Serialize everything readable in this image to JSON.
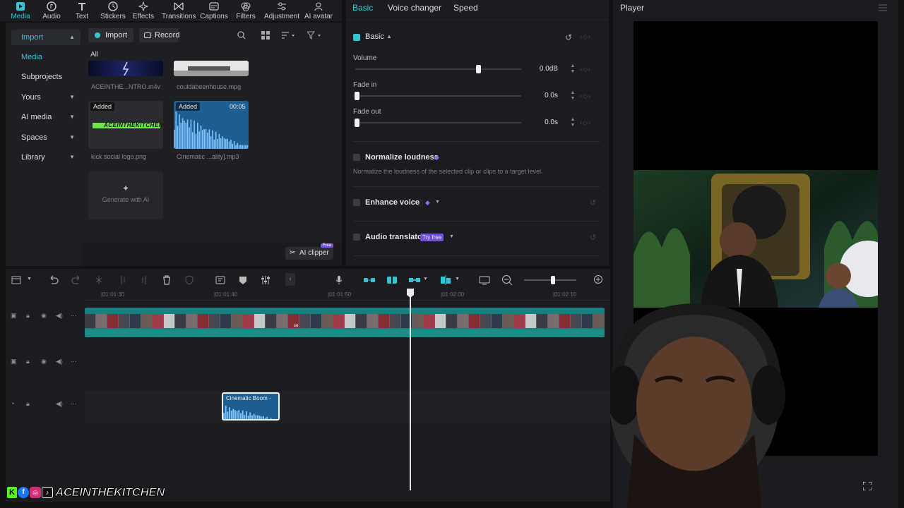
{
  "toolbar": {
    "tabs": [
      {
        "label": "Media",
        "icon": "media-icon"
      },
      {
        "label": "Audio",
        "icon": "audio-icon"
      },
      {
        "label": "Text",
        "icon": "text-icon"
      },
      {
        "label": "Stickers",
        "icon": "stickers-icon"
      },
      {
        "label": "Effects",
        "icon": "effects-icon"
      },
      {
        "label": "Transitions",
        "icon": "transitions-icon"
      },
      {
        "label": "Captions",
        "icon": "captions-icon"
      },
      {
        "label": "Filters",
        "icon": "filters-icon"
      },
      {
        "label": "Adjustment",
        "icon": "adjustment-icon"
      },
      {
        "label": "AI avatar",
        "icon": "ai-avatar-icon"
      }
    ]
  },
  "sidebar": {
    "items": [
      {
        "label": "Import"
      },
      {
        "label": "Media"
      },
      {
        "label": "Subprojects"
      },
      {
        "label": "Yours"
      },
      {
        "label": "AI media"
      },
      {
        "label": "Spaces"
      },
      {
        "label": "Library"
      }
    ]
  },
  "media": {
    "import_label": "Import",
    "record_label": "Record",
    "filter_label": "All",
    "files": [
      {
        "name": "ACEINTHE...NTRO.m4v",
        "badge": "",
        "duration": ""
      },
      {
        "name": "couldabeenhouse.mpg",
        "badge": "",
        "duration": ""
      },
      {
        "name": "kick social logo.png",
        "badge": "Added",
        "duration": ""
      },
      {
        "name": "Cinematic ...ality].mp3",
        "badge": "Added",
        "duration": "00:05"
      }
    ],
    "logo_text": "ACEINTHEKITCHEN",
    "generate_label": "Generate with AI",
    "ai_clipper_label": "AI clipper",
    "free_badge": "Free"
  },
  "props": {
    "tabs": [
      "Basic",
      "Voice changer",
      "Speed"
    ],
    "section": "Basic",
    "volume": {
      "label": "Volume",
      "value": "0.0dB",
      "level": 0.74
    },
    "fade_in": {
      "label": "Fade in",
      "value": "0.0s",
      "level": 0
    },
    "fade_out": {
      "label": "Fade out",
      "value": "0.0s",
      "level": 0
    },
    "normalize": {
      "label": "Normalize loudness",
      "desc": "Normalize the loudness of the selected clip or clips to a target level."
    },
    "enhance": {
      "label": "Enhance voice"
    },
    "translator": {
      "label": "Audio translator",
      "badge": "Try free"
    }
  },
  "player": {
    "title": "Player"
  },
  "timeline": {
    "ruler": [
      "|01:01:30",
      "|01:01:40",
      "|01:01:50",
      "|01:02:00",
      "|01:02:10"
    ],
    "audio_clip_label": "Cinematic Boom -",
    "zoom_level": 0.55,
    "playhead_position": 0.62
  },
  "overlay": {
    "channel_name": "ACEINTHEKITCHEN"
  },
  "colors": {
    "accent": "#35c6d4",
    "clip": "#1a7f80",
    "audio_clip": "#1d5f93",
    "premium": "#8b6cf6"
  }
}
